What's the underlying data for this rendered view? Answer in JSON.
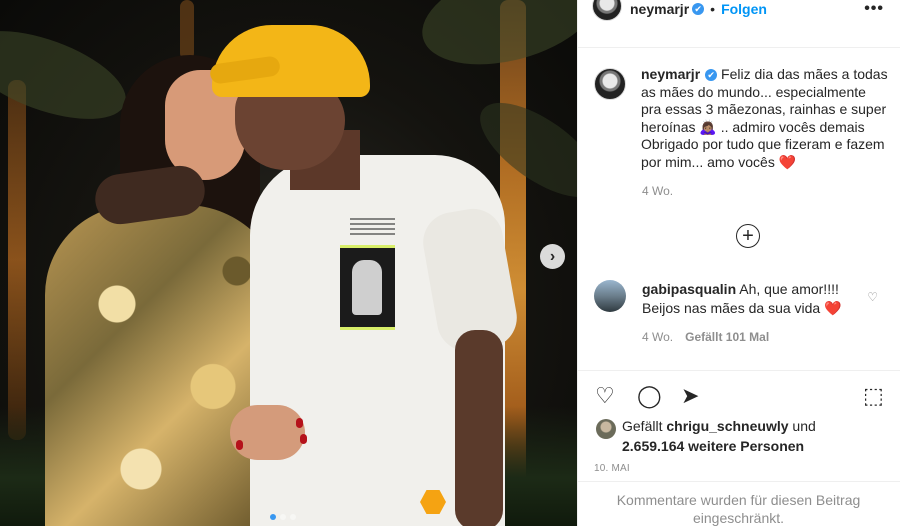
{
  "post": {
    "username": "neymarjr",
    "verified_mark": "✔",
    "bullet": "•",
    "follow_label": "Folgen",
    "more_label": "•••"
  },
  "caption": {
    "username": "neymarjr",
    "line1": "Feliz dia das mães a todas",
    "line2": "as mães do mundo... especialmente",
    "line3": "pra essas 3 mãezonas, rainhas e super",
    "line4_prefix": "heroínas",
    "line4_emoji": "🙇🏽‍♀️",
    "line4_suffix": ".. admiro vocês demais",
    "line5": "Obrigado por tudo que fizeram e fazem",
    "line6_prefix": "por mim... amo vocês",
    "line6_emoji": "❤️",
    "time_ago": "4 Wo."
  },
  "load_more_icon": "+",
  "comment": {
    "username": "gabipasqualin",
    "line1": "Ah, que amor!!!!",
    "line2_prefix": "Beijos nas mães da sua vida",
    "line2_emoji": "❤️",
    "time_ago": "4 Wo.",
    "likes_label": "Gefällt 101 Mal",
    "like_icon": "♡"
  },
  "actions": {
    "like_icon": "♡",
    "comment_icon": "◯",
    "share_icon": "➤",
    "save_icon": "⬚"
  },
  "likes": {
    "prefix": "Gefällt",
    "user": "chrigu_schneuwly",
    "mid": "und",
    "count": "2.659.164 weitere Personen"
  },
  "date": "10. MAI",
  "restricted": {
    "line1": "Kommentare wurden für diesen Beitrag",
    "line2": "eingeschränkt."
  },
  "media": {
    "next_icon": "›",
    "slides": 3,
    "active_slide": 1
  },
  "colors": {
    "accent": "#0095f6",
    "verified": "#3897f0",
    "heart": "#ed4956",
    "muted": "#8e8e8e"
  }
}
